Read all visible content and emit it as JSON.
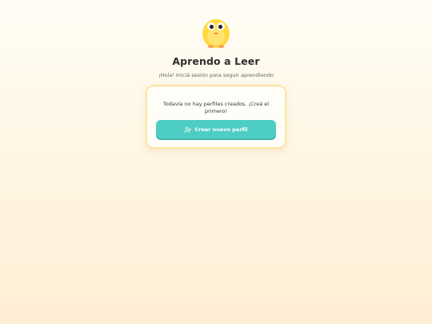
{
  "app": {
    "title": "Aprendo a Leer",
    "subtitle": "¡Hola! Iniciá sesión para seguir aprendiendo"
  },
  "profiles": {
    "empty_message": "Todavía no hay perfiles creados. ¡Creá el primero!",
    "create_button_label": "Crear nuevo perfil",
    "create_button_icon": "user-plus-icon"
  },
  "colors": {
    "accent": "#4ecdc4",
    "card_border": "#fbe6a0",
    "mascot": "#ffd93d"
  }
}
